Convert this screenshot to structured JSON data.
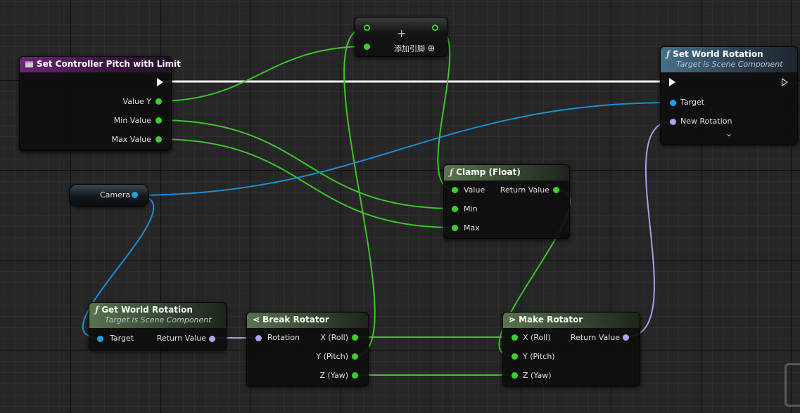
{
  "nodes": {
    "set_controller_pitch": {
      "title": "Set Controller Pitch with Limit",
      "pins": {
        "value_y": "Value Y",
        "min_value": "Min Value",
        "max_value": "Max Value"
      }
    },
    "add_pin_node": {
      "plus": "+",
      "add_pin_label": "添加引脚",
      "add_pin_icon": "⊕"
    },
    "set_world_rotation": {
      "title": "Set World Rotation",
      "subtitle": "Target is Scene Component",
      "pins": {
        "target": "Target",
        "new_rotation": "New Rotation"
      },
      "expand_icon": "⌄"
    },
    "camera": {
      "label": "Camera"
    },
    "clamp_float": {
      "title": "Clamp (Float)",
      "pins": {
        "value": "Value",
        "return_value": "Return Value",
        "min": "Min",
        "max": "Max"
      }
    },
    "get_world_rotation": {
      "title": "Get World Rotation",
      "subtitle": "Target is Scene Component",
      "pins": {
        "target": "Target",
        "return_value": "Return Value"
      }
    },
    "break_rotator": {
      "title": "Break Rotator",
      "pins": {
        "rotation": "Rotation",
        "x_roll": "X (Roll)",
        "y_pitch": "Y (Pitch)",
        "z_yaw": "Z (Yaw)"
      }
    },
    "make_rotator": {
      "title": "Make Rotator",
      "pins": {
        "x_roll": "X (Roll)",
        "y_pitch": "Y (Pitch)",
        "z_yaw": "Z (Yaw)",
        "return_value": "Return Value"
      }
    }
  },
  "colors": {
    "float_pin": "#3ad12a",
    "object_pin": "#1ea0e8",
    "rotator_pin": "#a4a9ec",
    "exec_pin": "#ffffff",
    "event_header": "#6d2477",
    "function_header": "#46708c",
    "pure_header": "#58744d"
  },
  "icons": {
    "function_glyph": "ƒ",
    "event_icon": "event-square-icon",
    "break_icon": "break-struct-icon",
    "make_icon": "make-struct-icon"
  }
}
